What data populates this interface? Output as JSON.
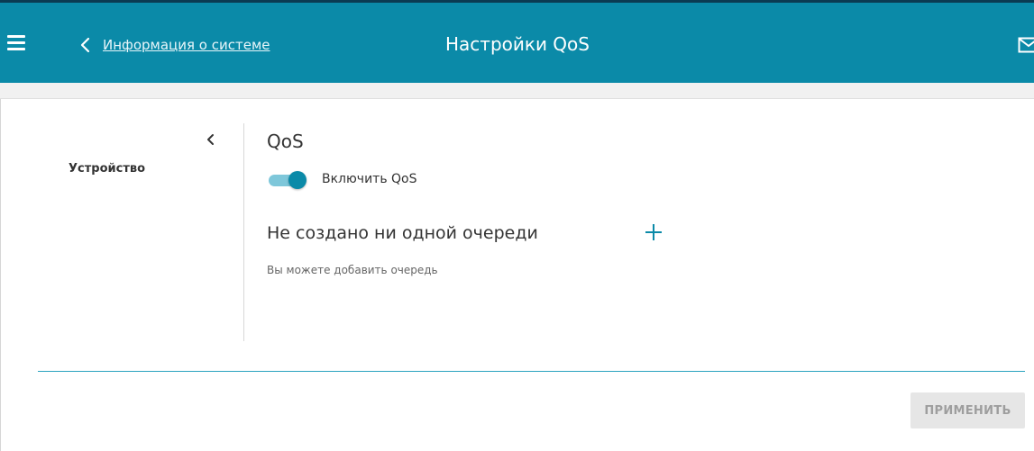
{
  "header": {
    "back_link_label": "Информация о системе",
    "title": "Настройки QoS",
    "background_color": "#0b8aa8",
    "icons": [
      "menu-icon",
      "chevron-left-icon",
      "mail-icon"
    ]
  },
  "sidebar": {
    "collapse_icon": "chevron-left-icon",
    "items": [
      {
        "label": "Устройство"
      }
    ]
  },
  "main": {
    "section_title": "QoS",
    "toggle": {
      "label": "Включить QoS",
      "checked": true
    },
    "queues": {
      "empty_title": "Не создано ни одной очереди",
      "empty_hint": "Вы можете добавить очередь",
      "add_icon": "plus-icon"
    }
  },
  "footer": {
    "apply_label": "ПРИМЕНИТЬ",
    "apply_enabled": false
  }
}
